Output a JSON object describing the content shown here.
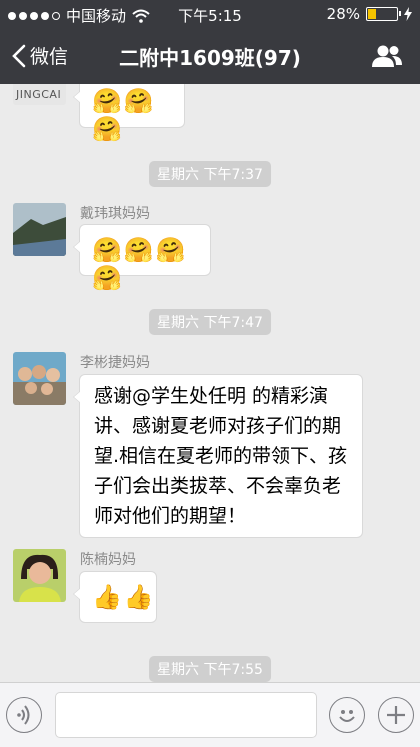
{
  "status_bar": {
    "carrier": "中国移动",
    "time": "下午5:15",
    "battery": "28%",
    "battery_level": 0.28
  },
  "nav": {
    "back_label": "微信",
    "title": "二附中1609班(97)"
  },
  "messages": [
    {
      "type": "emoji",
      "avatar_text": "JINGCAI",
      "content": "🤗🤗🤗"
    },
    {
      "type": "time",
      "text": "星期六 下午7:37"
    },
    {
      "type": "emoji",
      "sender": "戴玮琪妈妈",
      "content": "🤗🤗🤗🤗"
    },
    {
      "type": "time",
      "text": "星期六 下午7:47"
    },
    {
      "type": "text",
      "sender": "李彬捷妈妈",
      "content": "感谢@学生处任明 的精彩演讲、感谢夏老师对孩子们的期望.相信在夏老师的带领下、孩子们会出类拔萃、不会辜负老师对他们的期望！"
    },
    {
      "type": "emoji",
      "sender": "陈楠妈妈",
      "content": "👍👍"
    },
    {
      "type": "time",
      "text": "星期六 下午7:55"
    }
  ],
  "colors": {
    "bar": "#393a3f",
    "chat_bg": "#ebebeb",
    "battery": "#f5c400"
  }
}
